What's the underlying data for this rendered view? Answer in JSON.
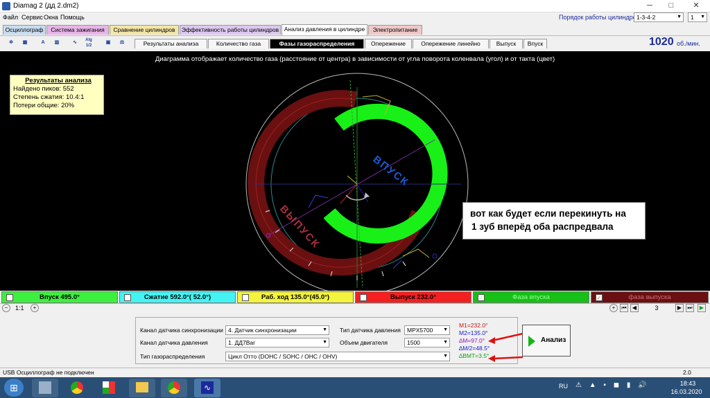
{
  "window": {
    "title": "Diamag 2 (дд 2.dm2)"
  },
  "menu": [
    "Файл",
    "Сервис",
    "Окна",
    "Помощь"
  ],
  "cyl_order": {
    "label": "Порядок работы цилиндров",
    "value": "1-3-4-2",
    "cyl_value": "1"
  },
  "main_tabs": [
    "Осциллограф",
    "Система зажигания",
    "Сравнение цилиндров",
    "Эффективность работы цилиндров",
    "Анализ давления в цилиндре",
    "Электропитание"
  ],
  "tool_icons": [
    "settings-icon",
    "chart-icon",
    "auto-icon",
    "bars-icon",
    "trend-icon",
    "alg-icon",
    "save-icon",
    "scale-icon"
  ],
  "tool_labels": [
    "",
    "",
    "",
    "",
    "",
    "Alg 1/2",
    "",
    ""
  ],
  "sub_tabs": [
    "Результаты анализа",
    "Количество газа",
    "Фазы газораспределения",
    "Опережение",
    "Опережение линейно",
    "Выпуск",
    "Впуск"
  ],
  "rpm": {
    "value": "1020",
    "unit": "об./мин."
  },
  "diagram": {
    "description": "Диаграмма отображает количество газа (расстояние от центра) в зависимости от угла поворота коленвала (угол) и от такта (цвет)",
    "intake_label": "ВПУСК",
    "exhaust_label": "ВЫПУСК"
  },
  "results": {
    "title": "Результаты анализа",
    "lines": [
      "Найдено пиков: 552",
      "Степень сжатия: 10.4:1",
      "Потери общие: 20%"
    ]
  },
  "note": {
    "line1": "вот как будет если перекинуть на",
    "line2": "1 зуб вперёд оба распредвала"
  },
  "phases": [
    {
      "label": "Впуск 495.0°",
      "color": "#3ef03e",
      "checked": false
    },
    {
      "label": "Сжатие 592.0°( 52.0°)",
      "color": "#44f4f4",
      "checked": false
    },
    {
      "label": "Раб. ход 135.0°(45.0°)",
      "color": "#f4f43c",
      "checked": false
    },
    {
      "label": "Выпуск 232.0°",
      "color": "#f42020",
      "checked": false
    },
    {
      "label": "Фаза впуска",
      "color": "#16c016",
      "checked": true
    },
    {
      "label": "фаза выпуска",
      "color": "#6a1010",
      "checked": true
    }
  ],
  "zoom": "1:1",
  "page": "3",
  "bottom": {
    "sync_label": "Канал датчика синхронизации",
    "sync_value": "4.  Датчик синхронизации",
    "pressure_label": "Канал датчика давления",
    "pressure_value": "1.  ДД7Bar",
    "timing_label": "Тип газораспределения",
    "timing_value": "Цикл Отто (DOHC / SOHC / OHC / OHV)",
    "sensor_type_label": "Тип датчика давления",
    "sensor_type_value": "MPX5700",
    "engine_volume_label": "Объем двигателя",
    "engine_volume_value": "1500"
  },
  "markers": [
    {
      "text": "M1=232.0°",
      "color": "#cc1111"
    },
    {
      "text": "M2=135.0°",
      "color": "#1a1acc"
    },
    {
      "text": "∆M=97.0°",
      "color": "#8a18b8"
    },
    {
      "text": "∆M/2=48.5°",
      "color": "#1a1acc"
    },
    {
      "text": "∆ВМТ=3.5°",
      "color": "#11a011"
    }
  ],
  "analyze_label": "Анализ",
  "status": {
    "left": "USB Осциллограф не подключен",
    "right": "2.0"
  },
  "taskbar": {
    "lang": "RU",
    "time": "18:43",
    "date": "16.03.2020"
  }
}
